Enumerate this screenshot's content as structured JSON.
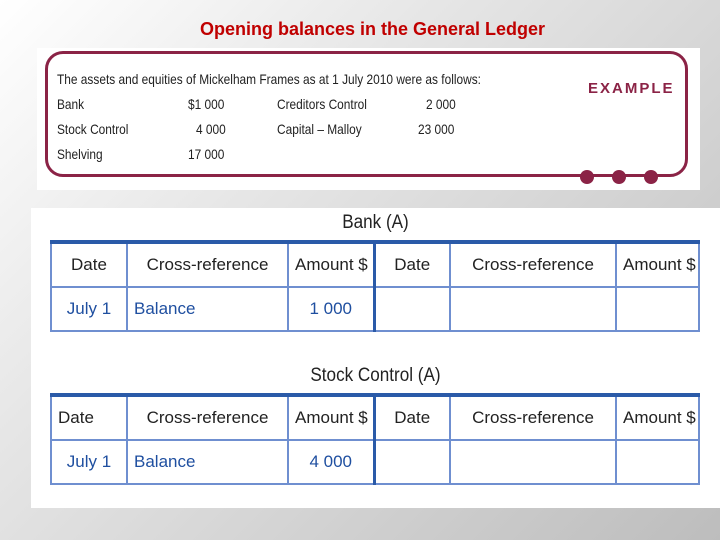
{
  "slide_title": "Opening balances in the General Ledger",
  "example": {
    "label": "EXAMPLE",
    "intro": "The assets and equities of Mickelham Frames as at 1 July 2010 were as follows:",
    "items": [
      {
        "name": "Bank",
        "amount": "$1 000"
      },
      {
        "name": "Stock Control",
        "amount": "4 000"
      },
      {
        "name": "Shelving",
        "amount": "17 000"
      },
      {
        "name": "Creditors Control",
        "amount": "2 000"
      },
      {
        "name": "Capital – Malloy",
        "amount": "23 000"
      }
    ],
    "accent_color": "#8b2346"
  },
  "ledgers": [
    {
      "title": "Bank (A)",
      "headers": [
        "Date",
        "Cross-reference",
        "Amount $",
        "Date",
        "Cross-reference",
        "Amount $"
      ],
      "row": [
        "July 1",
        "Balance",
        "1 000",
        "",
        "",
        ""
      ]
    },
    {
      "title": "Stock Control (A)",
      "headers": [
        "Date",
        "Cross-reference",
        "Amount $",
        "Date",
        "Cross-reference",
        "Amount $"
      ],
      "row": [
        "July 1",
        "Balance",
        "4 000",
        "",
        "",
        ""
      ]
    }
  ]
}
